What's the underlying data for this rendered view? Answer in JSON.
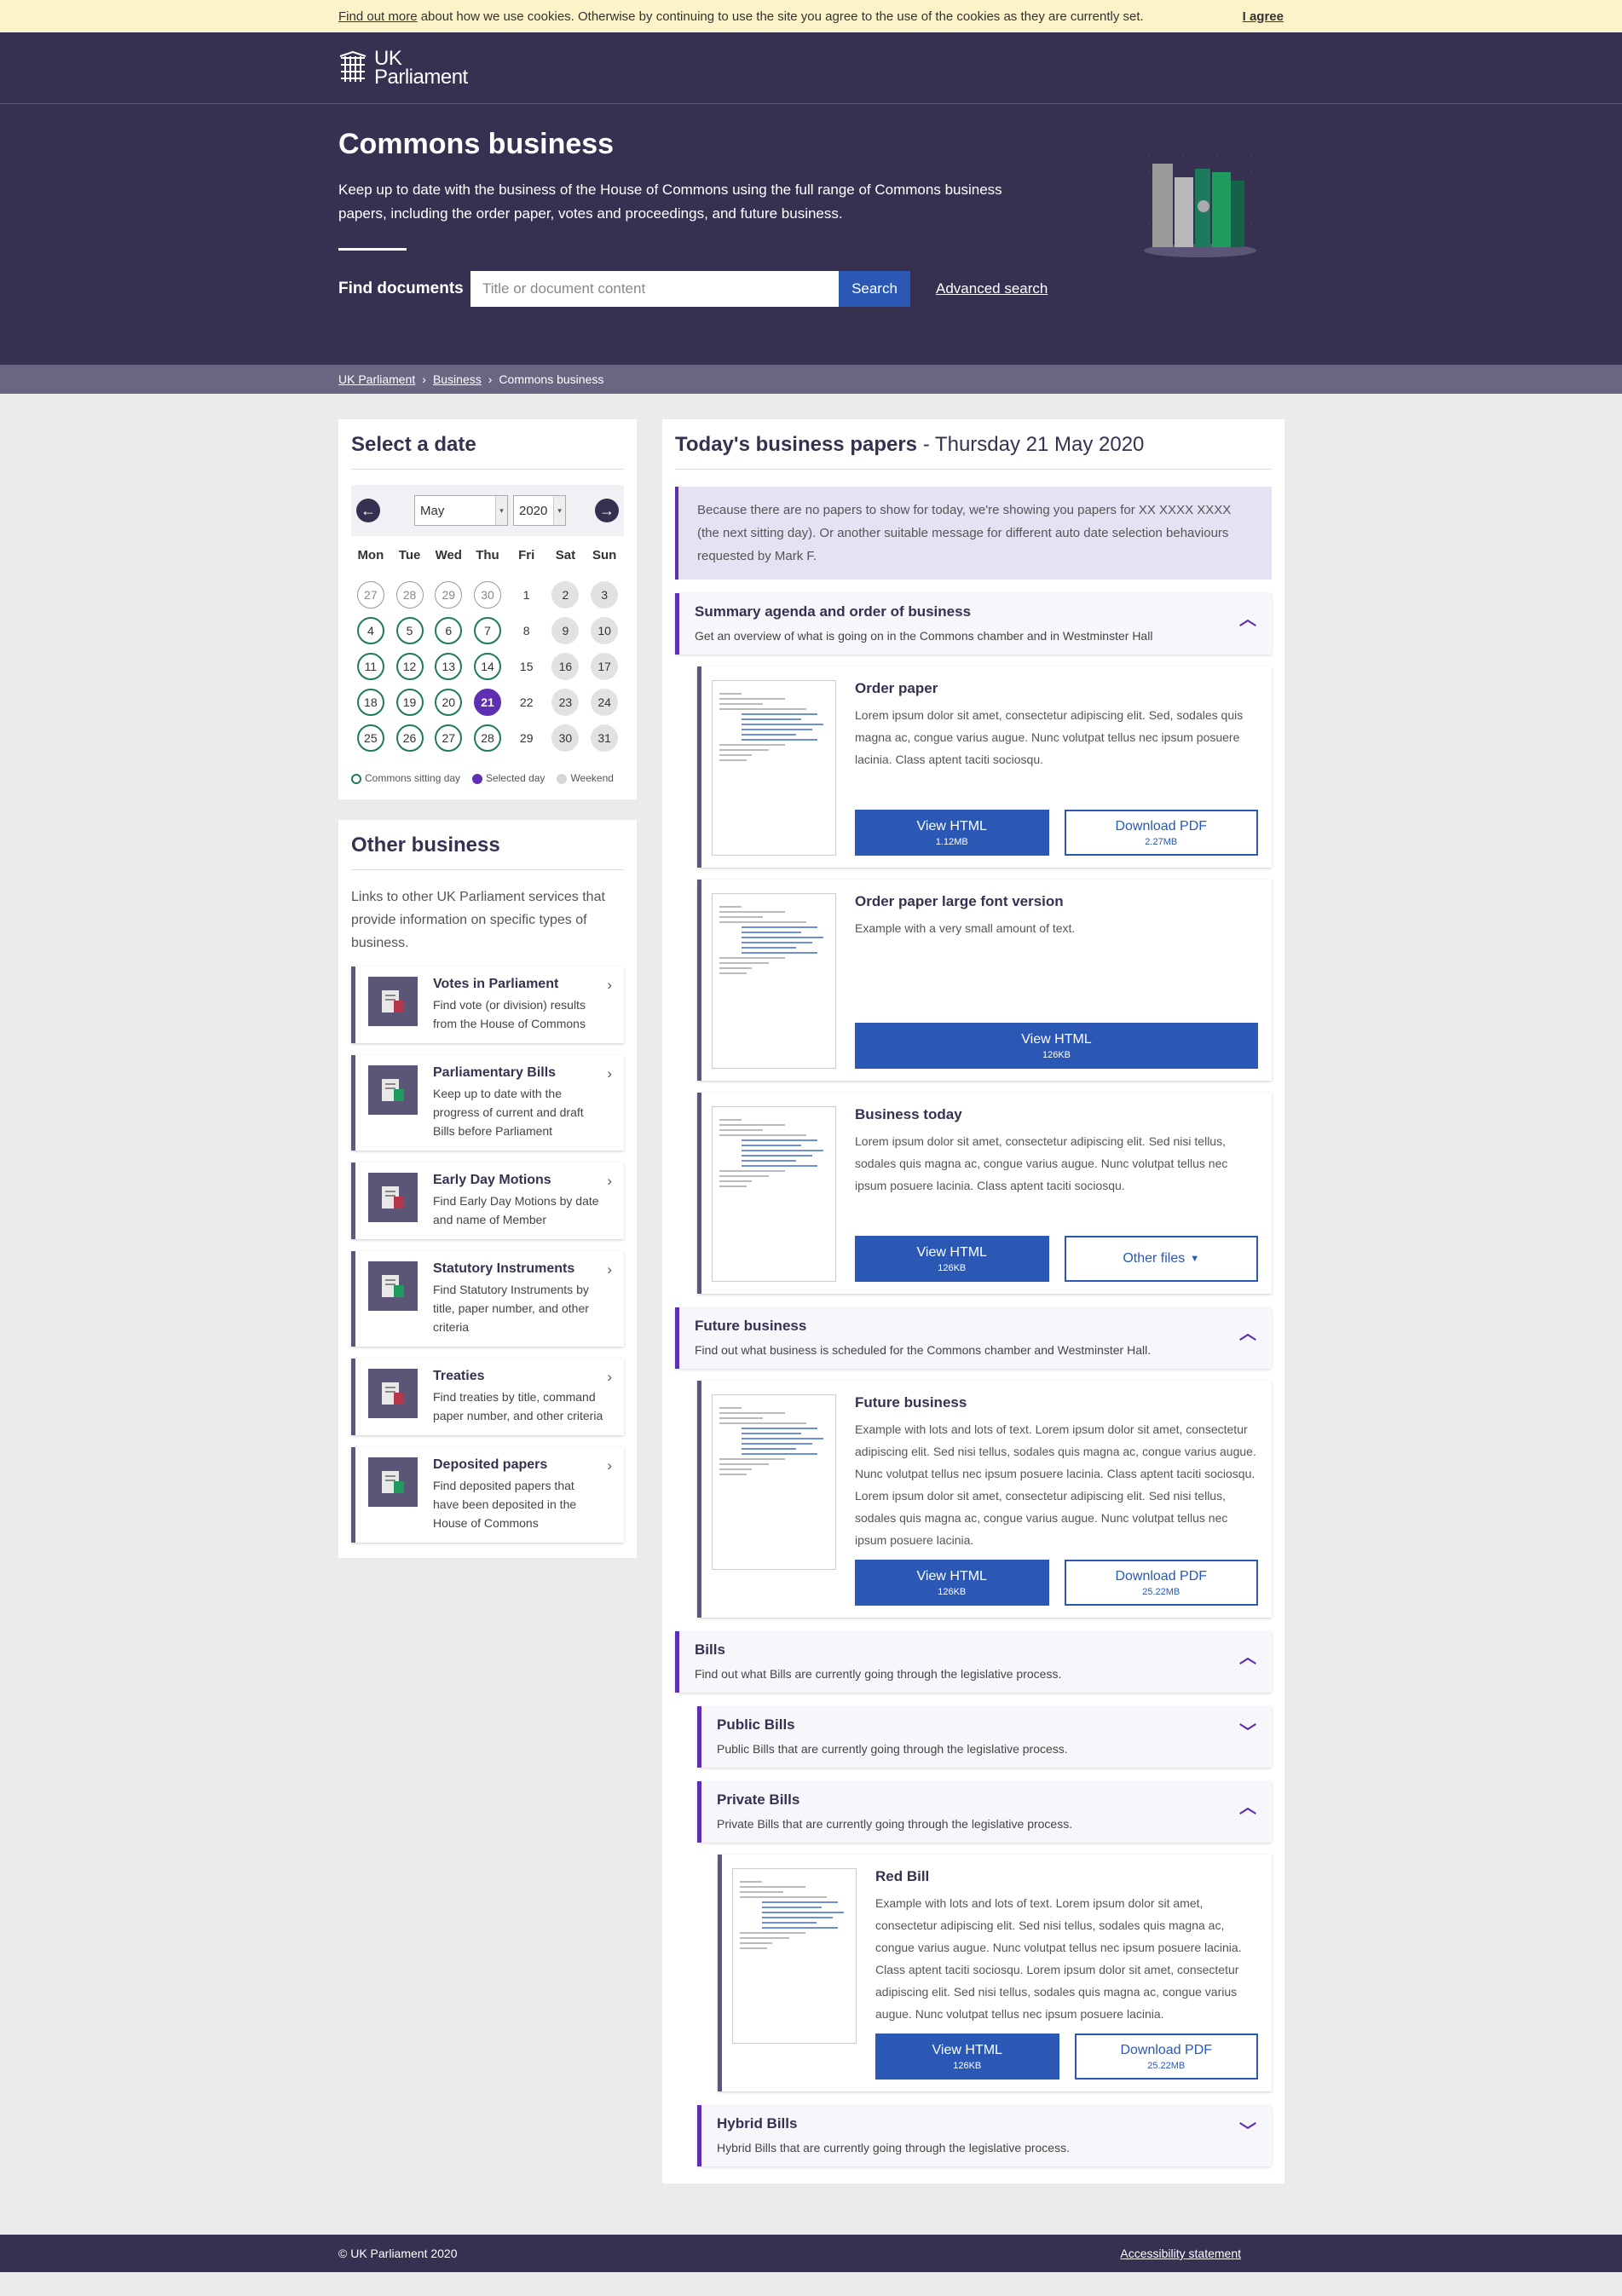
{
  "cookie": {
    "link": "Find out more",
    "text": "about how we use cookies. Otherwise by continuing to use the site you agree to the use of the cookies as they are currently set.",
    "agree": "I agree"
  },
  "logo": {
    "line1": "UK",
    "line2": "Parliament"
  },
  "hero": {
    "title": "Commons business",
    "lead": "Keep up to date with the business of the House of Commons using the full range of Commons business papers, including the order paper, votes and proceedings, and future business.",
    "find_label": "Find documents",
    "search_placeholder": "Title or document content",
    "search_button": "Search",
    "advanced": "Advanced search"
  },
  "breadcrumb": [
    "UK Parliament",
    "Business",
    "Commons business"
  ],
  "calendar": {
    "title": "Select a date",
    "month": "May",
    "year": "2020",
    "days": [
      "Mon",
      "Tue",
      "Wed",
      "Thu",
      "Fri",
      "Sat",
      "Sun"
    ],
    "weeks": [
      [
        "27",
        "28",
        "29",
        "30",
        "1",
        "2",
        "3"
      ],
      [
        "4",
        "5",
        "6",
        "7",
        "8",
        "9",
        "10"
      ],
      [
        "11",
        "12",
        "13",
        "14",
        "15",
        "16",
        "17"
      ],
      [
        "18",
        "19",
        "20",
        "21",
        "22",
        "23",
        "24"
      ],
      [
        "25",
        "26",
        "27",
        "28",
        "29",
        "30",
        "31"
      ]
    ],
    "legend": [
      "Commons sitting day",
      "Selected day",
      "Weekend"
    ]
  },
  "other": {
    "title": "Other business",
    "intro": "Links to other UK Parliament services that provide information on specific types of business.",
    "items": [
      {
        "title": "Votes in Parliament",
        "desc": "Find vote (or division) results from the House of Commons"
      },
      {
        "title": "Parliamentary Bills",
        "desc": "Keep up to date with the progress of current and draft Bills before Parliament"
      },
      {
        "title": "Early Day Motions",
        "desc": "Find Early Day Motions by date and name of Member"
      },
      {
        "title": "Statutory Instruments",
        "desc": "Find Statutory Instruments by title, paper number, and other criteria"
      },
      {
        "title": "Treaties",
        "desc": "Find treaties by title, command paper number, and other criteria"
      },
      {
        "title": "Deposited papers",
        "desc": "Find deposited papers that have been deposited in the House of Commons"
      }
    ]
  },
  "today": {
    "title": "Today's business papers",
    "date": "- Thursday 21 May 2020",
    "notice": "Because there are no papers to show for today, we're showing you papers for XX XXXX XXXX (the next sitting day). Or another suitable message for different auto date selection behaviours requested by Mark F."
  },
  "sections": {
    "summary": {
      "title": "Summary agenda and order of business",
      "desc": "Get an overview of what is going on in the Commons chamber and in Westminster Hall"
    },
    "future": {
      "title": "Future business",
      "desc": "Find out what business is scheduled for the Commons chamber and Westminster Hall."
    },
    "bills": {
      "title": "Bills",
      "desc": "Find out what Bills are currently going through the legislative process."
    },
    "public": {
      "title": "Public Bills",
      "desc": "Public Bills that are currently going through the legislative process."
    },
    "private": {
      "title": "Private Bills",
      "desc": "Private Bills that are currently going through the legislative process."
    },
    "hybrid": {
      "title": "Hybrid Bills",
      "desc": "Hybrid Bills that are currently going through the legislative process."
    }
  },
  "docs": {
    "order": {
      "title": "Order paper",
      "desc": "Lorem ipsum dolor sit amet, consectetur adipiscing elit. Sed, sodales quis magna ac, congue varius augue. Nunc volutpat tellus nec ipsum posuere lacinia. Class aptent taciti sociosqu.",
      "view": "View HTML",
      "view_size": "1.12MB",
      "pdf": "Download PDF",
      "pdf_size": "2.27MB"
    },
    "large": {
      "title": "Order paper large font version",
      "desc": "Example with a very small amount of text.",
      "view": "View HTML",
      "view_size": "126KB"
    },
    "today": {
      "title": "Business today",
      "desc": "Lorem ipsum dolor sit amet, consectetur adipiscing elit. Sed nisi tellus, sodales quis magna ac, congue varius augue. Nunc volutpat tellus nec ipsum posuere lacinia. Class aptent taciti sociosqu.",
      "view": "View HTML",
      "view_size": "126KB",
      "other": "Other files"
    },
    "future": {
      "title": "Future business",
      "desc": "Example with lots and lots of text. Lorem ipsum dolor sit amet, consectetur adipiscing elit. Sed nisi tellus, sodales quis magna ac, congue varius augue. Nunc volutpat tellus nec ipsum posuere lacinia. Class aptent taciti sociosqu. Lorem ipsum dolor sit amet, consectetur adipiscing elit. Sed nisi tellus, sodales quis magna ac, congue varius augue. Nunc volutpat tellus nec ipsum posuere lacinia.",
      "view": "View HTML",
      "view_size": "126KB",
      "pdf": "Download PDF",
      "pdf_size": "25.22MB"
    },
    "red": {
      "title": "Red Bill",
      "desc": "Example with lots and lots of text. Lorem ipsum dolor sit amet, consectetur adipiscing elit. Sed nisi tellus, sodales quis magna ac, congue varius augue. Nunc volutpat tellus nec ipsum posuere lacinia. Class aptent taciti sociosqu. Lorem ipsum dolor sit amet, consectetur adipiscing elit. Sed nisi tellus, sodales quis magna ac, congue varius augue. Nunc volutpat tellus nec ipsum posuere lacinia.",
      "view": "View HTML",
      "view_size": "126KB",
      "pdf": "Download PDF",
      "pdf_size": "25.22MB"
    }
  },
  "footer": {
    "copyright": "© UK Parliament 2020",
    "accessibility": "Accessibility statement"
  },
  "colors": {
    "brand": "#373151",
    "accent": "#5e2fb3",
    "button": "#2a58b4",
    "sitting": "#1d7a5a"
  }
}
